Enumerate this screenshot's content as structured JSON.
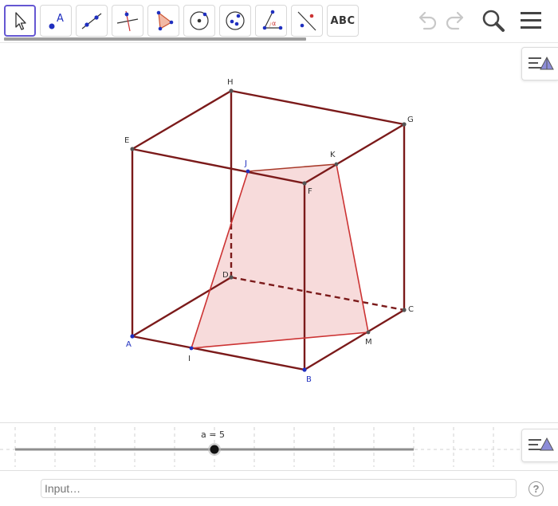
{
  "toolbar": {
    "tools": [
      {
        "name": "move-tool",
        "icon": "arrow-cursor-icon",
        "active": true
      },
      {
        "name": "point-tool",
        "icon": "point-icon",
        "label": "A"
      },
      {
        "name": "line-tool",
        "icon": "line-through-points-icon"
      },
      {
        "name": "perpendicular-tool",
        "icon": "perpendicular-line-icon"
      },
      {
        "name": "polygon-tool",
        "icon": "polygon-icon"
      },
      {
        "name": "circle-tool",
        "icon": "circle-center-point-icon"
      },
      {
        "name": "ellipse-tool",
        "icon": "conic-icon"
      },
      {
        "name": "angle-tool",
        "icon": "angle-icon",
        "label": "α"
      },
      {
        "name": "reflect-tool",
        "icon": "reflect-about-line-icon"
      },
      {
        "name": "text-tool",
        "icon": "text-icon",
        "label": "ABC"
      }
    ],
    "undo_icon": "undo-icon",
    "redo_icon": "redo-icon",
    "search_icon": "search-icon",
    "menu_icon": "hamburger-menu-icon"
  },
  "graphics": {
    "style_bar_icon": "graphics-style-bar-icon",
    "colors": {
      "edge": "#7b1a1a",
      "section_fill": "#f4cccc",
      "section_edge": "#cc3333",
      "point": "#1f2fbf"
    },
    "vertices": {
      "A": "A",
      "B": "B",
      "C": "C",
      "D": "D",
      "E": "E",
      "F": "F",
      "G": "G",
      "H": "H",
      "I": "I",
      "J": "J",
      "K": "K",
      "M": "M"
    }
  },
  "slider": {
    "label": "a = 5",
    "value": 5,
    "min": 0,
    "max": 10,
    "style_bar_icon": "algebra-style-bar-icon"
  },
  "input_bar": {
    "placeholder": "Input…",
    "help_label": "?"
  }
}
